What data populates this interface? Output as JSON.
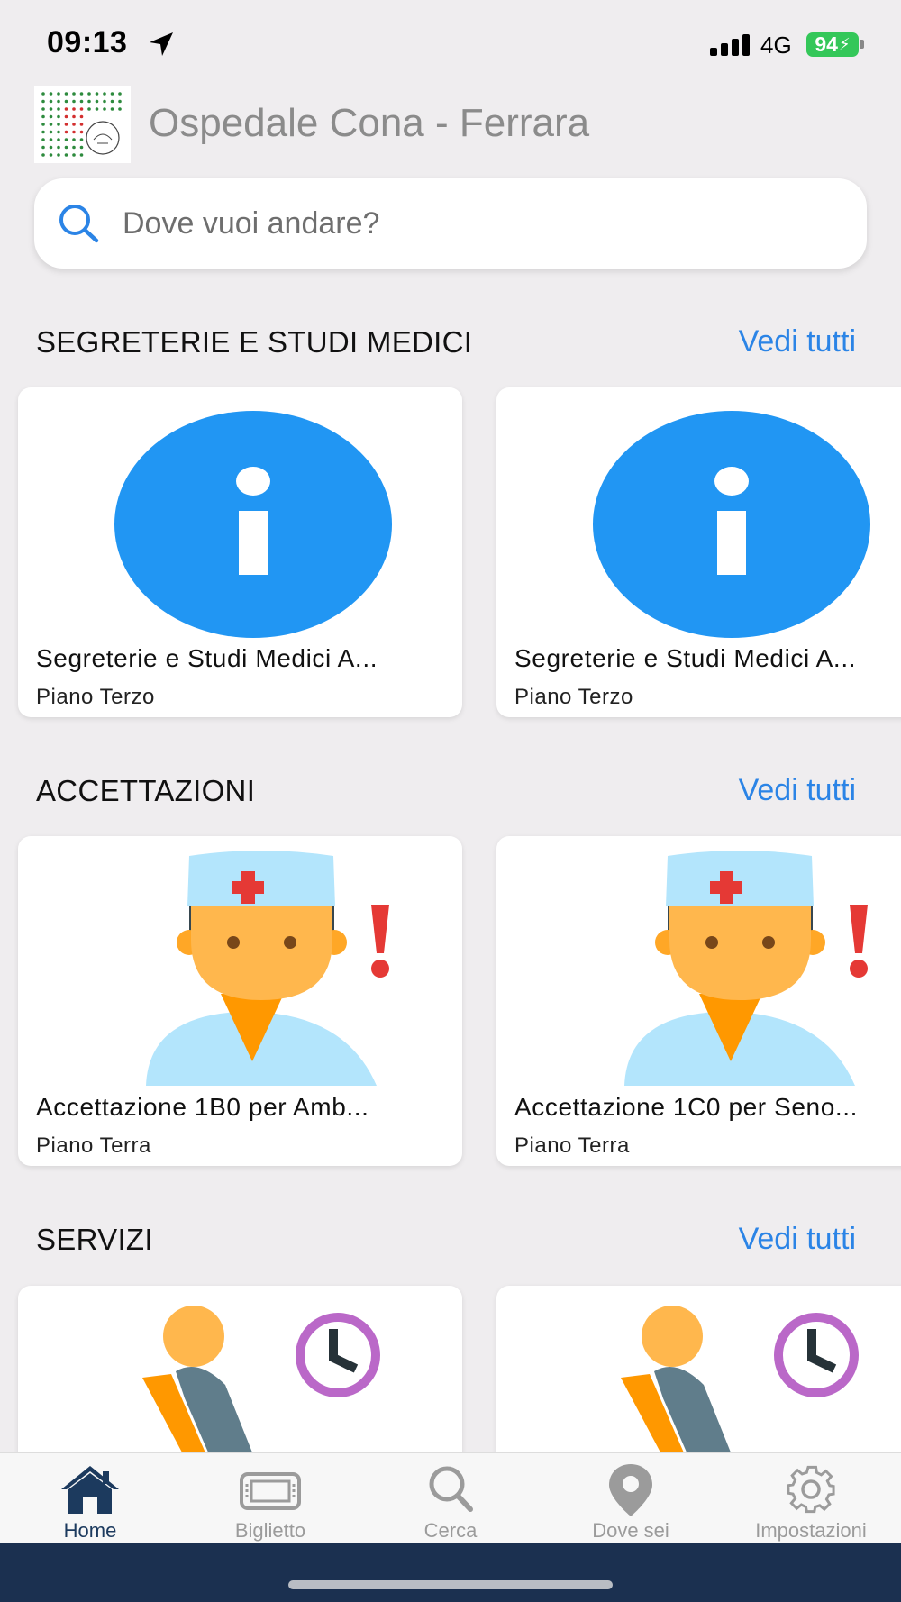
{
  "status_bar": {
    "time": "09:13",
    "network": "4G",
    "battery": "94"
  },
  "header": {
    "title": "Ospedale Cona - Ferrara"
  },
  "search": {
    "placeholder": "Dove vuoi andare?"
  },
  "sections": [
    {
      "title": "SEGRETERIE E STUDI MEDICI",
      "see_all": "Vedi tutti",
      "icon": "info-icon",
      "cards": [
        {
          "title": "Segreterie e Studi Medici A...",
          "subtitle": "Piano Terzo"
        },
        {
          "title": "Segreterie e Studi Medici A...",
          "subtitle": "Piano Terzo"
        }
      ]
    },
    {
      "title": "ACCETTAZIONI",
      "see_all": "Vedi tutti",
      "icon": "nurse-alert-icon",
      "cards": [
        {
          "title": "Accettazione 1B0 per Amb...",
          "subtitle": "Piano Terra"
        },
        {
          "title": "Accettazione 1C0 per Seno...",
          "subtitle": "Piano Terra"
        }
      ]
    },
    {
      "title": "SERVIZI",
      "see_all": "Vedi tutti",
      "icon": "waiting-room-icon",
      "cards": [
        {},
        {}
      ]
    }
  ],
  "tabs": [
    {
      "label": "Home",
      "icon": "home-icon",
      "active": true
    },
    {
      "label": "Biglietto",
      "icon": "ticket-icon",
      "active": false
    },
    {
      "label": "Cerca",
      "icon": "search-icon",
      "active": false
    },
    {
      "label": "Dove sei",
      "icon": "location-pin-icon",
      "active": false
    },
    {
      "label": "Impostazioni",
      "icon": "gear-icon",
      "active": false
    }
  ],
  "colors": {
    "accent": "#2b84e6",
    "info_blue": "#2196f3",
    "tab_active": "#1c3a5e",
    "tab_inactive": "#9b9b9b",
    "battery": "#34c759",
    "bottom_bar": "#1b3050"
  }
}
